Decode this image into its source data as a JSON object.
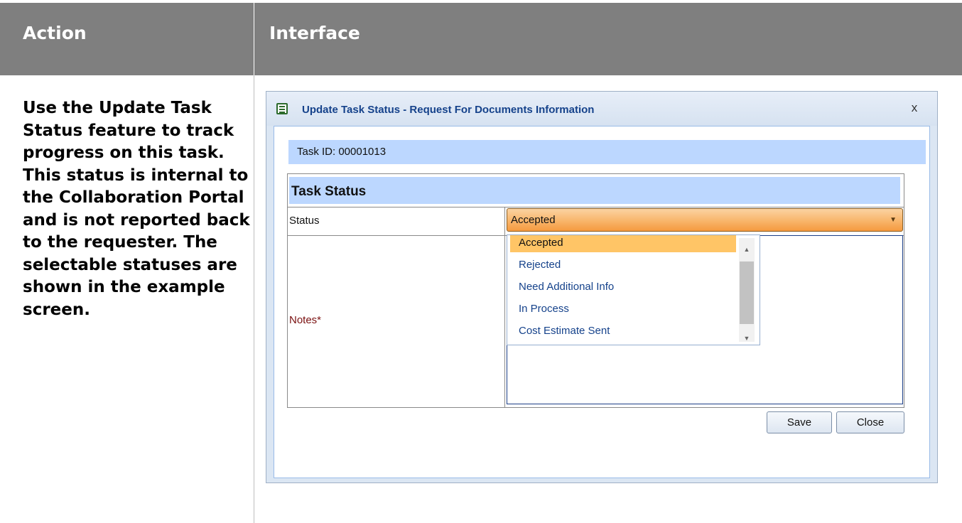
{
  "header": {
    "action": "Action",
    "interface": "Interface"
  },
  "action_text": "Use the Update Task Status feature to track progress on this task. This status is internal to the Collaboration Portal and is not reported back to the requester. The selectable statuses are shown in the example screen.",
  "dialog": {
    "title": "Update Task Status - Request For Documents Information",
    "close_label": "x",
    "task_id": "Task ID: 00001013",
    "section_header": "Task Status",
    "status_label": "Status",
    "status_value": "Accepted",
    "notes_label": "Notes*",
    "options": [
      "Accepted",
      "Rejected",
      "Need Additional Info",
      "In Process",
      "Cost Estimate Sent"
    ],
    "save_label": "Save",
    "close_button_label": "Close"
  },
  "colors": {
    "header_bg": "#7f7f7f",
    "select_accent": "#f8b56a",
    "highlight": "#ffc566",
    "title_text": "#15428b"
  }
}
